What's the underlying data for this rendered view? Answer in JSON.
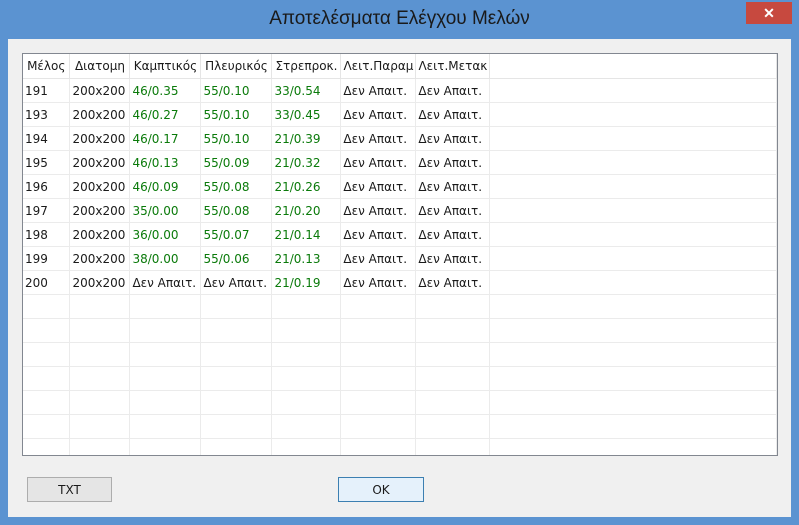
{
  "window": {
    "title": "Αποτελέσματα Ελέγχου Μελών",
    "close_glyph": "✕"
  },
  "table": {
    "headers": [
      "Μέλος",
      "Διατομη",
      "Καμπτικός",
      "Πλευρικός",
      "Στρεπροκ.",
      "Λειτ.Παραμ",
      "Λειτ.Μετακ"
    ],
    "rows": [
      [
        "191",
        "200x200",
        "46/0.35",
        "55/0.10",
        "33/0.54",
        "Δεν Απαιτ.",
        "Δεν Απαιτ."
      ],
      [
        "193",
        "200x200",
        "46/0.27",
        "55/0.10",
        "33/0.45",
        "Δεν Απαιτ.",
        "Δεν Απαιτ."
      ],
      [
        "194",
        "200x200",
        "46/0.17",
        "55/0.10",
        "21/0.39",
        "Δεν Απαιτ.",
        "Δεν Απαιτ."
      ],
      [
        "195",
        "200x200",
        "46/0.13",
        "55/0.09",
        "21/0.32",
        "Δεν Απαιτ.",
        "Δεν Απαιτ."
      ],
      [
        "196",
        "200x200",
        "46/0.09",
        "55/0.08",
        "21/0.26",
        "Δεν Απαιτ.",
        "Δεν Απαιτ."
      ],
      [
        "197",
        "200x200",
        "35/0.00",
        "55/0.08",
        "21/0.20",
        "Δεν Απαιτ.",
        "Δεν Απαιτ."
      ],
      [
        "198",
        "200x200",
        "36/0.00",
        "55/0.07",
        "21/0.14",
        "Δεν Απαιτ.",
        "Δεν Απαιτ."
      ],
      [
        "199",
        "200x200",
        "38/0.00",
        "55/0.06",
        "21/0.13",
        "Δεν Απαιτ.",
        "Δεν Απαιτ."
      ],
      [
        "200",
        "200x200",
        "Δεν Απαιτ.",
        "Δεν Απαιτ.",
        "21/0.19",
        "Δεν Απαιτ.",
        "Δεν Απαιτ."
      ]
    ]
  },
  "buttons": {
    "txt": "TXT",
    "ok": "OK"
  },
  "colors": {
    "ok_text": "#0a7a0a",
    "titlebar": "#5b93d1",
    "close": "#c7493f"
  }
}
